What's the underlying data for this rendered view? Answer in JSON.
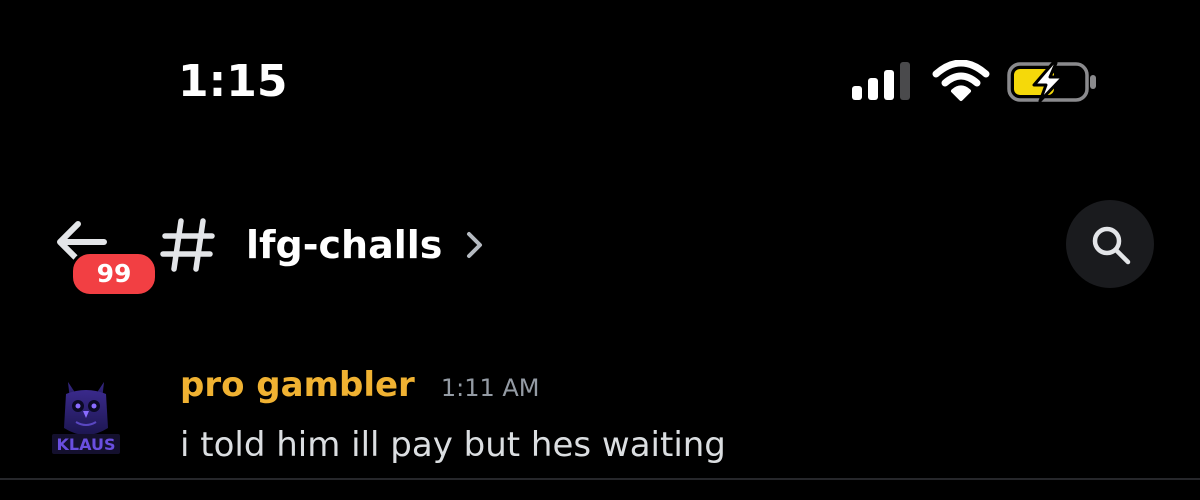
{
  "status_bar": {
    "time": "1:15",
    "signal_icon": "cellular-signal-icon",
    "wifi_icon": "wifi-icon",
    "battery_icon": "battery-charging-icon",
    "battery_color": "#f5d90a"
  },
  "header": {
    "back_icon": "arrow-left-icon",
    "unread_badge": "99",
    "channel_icon": "hash-icon",
    "channel_name": "lfg-challs",
    "chevron_icon": "chevron-right-icon",
    "search_icon": "search-icon",
    "badge_color": "#f23f43"
  },
  "messages": [
    {
      "author": "pro gambler",
      "author_color": "#f0b232",
      "timestamp": "1:11 AM",
      "content": "i told him ill pay but hes waiting",
      "avatar": {
        "icon": "owl-avatar-icon",
        "logo_text": "KLAUS"
      }
    }
  ]
}
